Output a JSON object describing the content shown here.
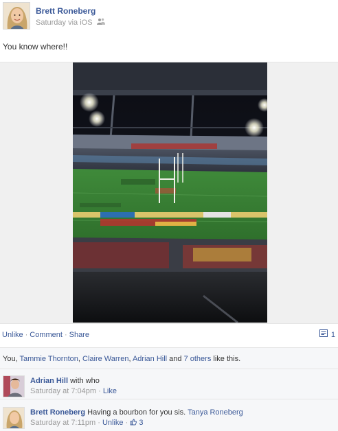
{
  "post": {
    "author": "Brett Roneberg",
    "meta": "Saturday via iOS",
    "text": "You know where!!"
  },
  "actions": {
    "unlike": "Unlike",
    "comment": "Comment",
    "share": "Share",
    "separator": "·",
    "comment_count": "1"
  },
  "likes": {
    "prefix": "You, ",
    "people": [
      "Tammie Thornton",
      "Claire Warren",
      "Adrian Hill"
    ],
    "and_text": " and ",
    "others": "7 others",
    "suffix": " like this.",
    "comma": ", "
  },
  "comments": [
    {
      "author": "Adrian Hill",
      "text": "with who",
      "time": "Saturday at 7:04pm",
      "action": "Like"
    },
    {
      "author": "Brett Roneberg",
      "text": "Having a bourbon for you sis.",
      "mention": "Tanya Roneberg",
      "time": "Saturday at 7:11pm",
      "action": "Unlike",
      "like_count": "3"
    }
  ],
  "colors": {
    "link": "#3b5998",
    "muted": "#999999",
    "ufi_bg": "#f6f7f9"
  }
}
